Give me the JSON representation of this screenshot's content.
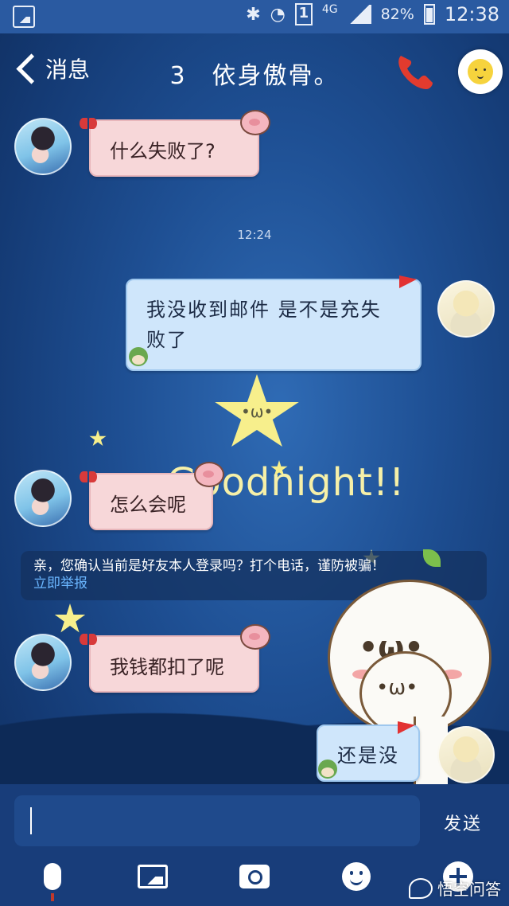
{
  "status_bar": {
    "network": "4G",
    "sim": "1",
    "battery": "82%",
    "time": "12:38"
  },
  "header": {
    "back_label": "消息",
    "title": "3　依身傲骨。"
  },
  "messages": [
    {
      "side": "left",
      "text": "什么失败了?"
    },
    {
      "side": "right",
      "text": "我没收到邮件 是不是充失败了"
    },
    {
      "side": "left",
      "text": "怎么会呢"
    },
    {
      "side": "left",
      "text": "我钱都扣了呢"
    },
    {
      "side": "right",
      "text": "还是没"
    }
  ],
  "timestamp": "12:24",
  "background_text": "Goodnight!!",
  "notice": {
    "text": "亲，您确认当前是好友本人登录吗？打个电话，谨防被骗！",
    "link": "立即举报"
  },
  "sticker_text": {
    "big": "•ω•",
    "small": "•ω•"
  },
  "input": {
    "value": "",
    "send_label": "发送"
  },
  "toolbar": [
    "microphone-icon",
    "picture-icon",
    "camera-icon",
    "emoji-icon",
    "plus-icon"
  ],
  "watermark": "悟空问答",
  "colors": {
    "status_bar": "#2a5aa1",
    "input_bar": "#183d7a",
    "bubble_pink": "#f7d7d9",
    "bubble_blue": "#cfe6fb",
    "phone_icon": "#e23b2e",
    "link": "#6ab6ff"
  }
}
